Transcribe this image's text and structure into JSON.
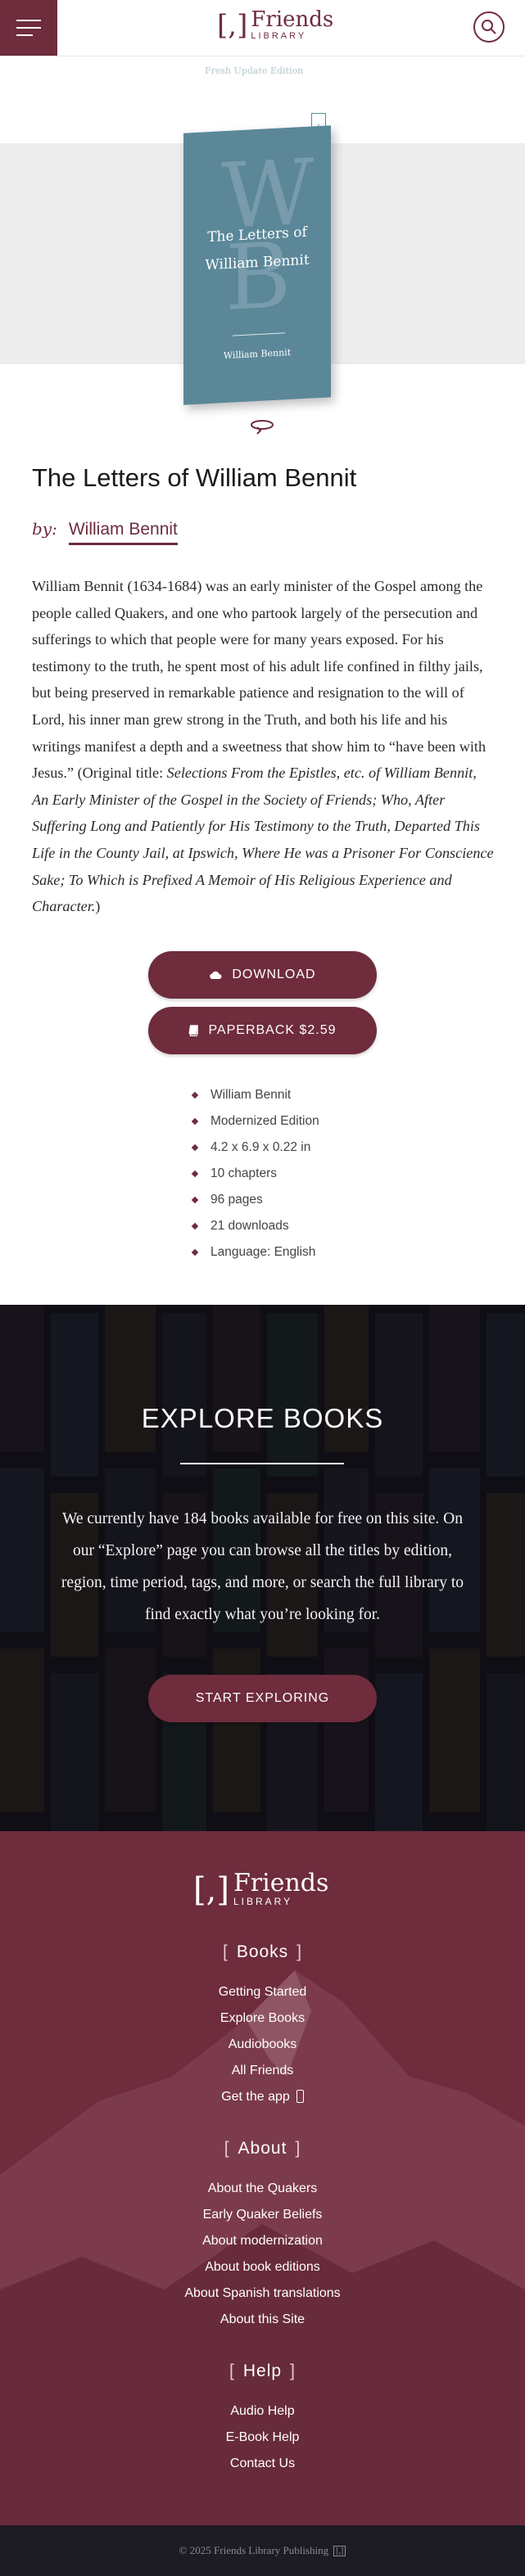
{
  "header": {
    "logo_bracket": "[,]",
    "logo_word": "Friends",
    "logo_sub": "LIBRARY",
    "menu_icon": "hamburger-icon",
    "search_icon": "search-icon"
  },
  "book_cover": {
    "edition_tag": "Fresh Update Edition",
    "title_line1": "The Letters of",
    "title_line2": "William Bennit",
    "big_letters": "WB",
    "author": "William Bennit",
    "color": "#5b8799"
  },
  "book": {
    "title": "The Letters of William Bennit",
    "by_label": "by:",
    "author": "William Bennit",
    "description_plain": "William Bennit (1634-1684) was an early minister of the Gospel among the people called Quakers, and one who partook largely of the persecution and sufferings to which that people were for many years exposed. For his testimony to the truth, he spent most of his adult life confined in filthy jails, but being preserved in remarkable patience and resignation to the will of Lord, his inner man grew strong in the Truth, and both his life and his writings manifest a depth and a sweetness that show him to “have been with Jesus.” (Original title: ",
    "description_italic": "Selections From the Epistles, etc. of William Bennit, An Early Minister of the Gospel in the Society of Friends; Who, After Suffering Long and Patiently for His Testimony to the Truth, Departed This Life in the County Jail, at Ipswich, Where He was a Prisoner For Conscience Sake; To Which is Prefixed A Memoir of His Religious Experience and Character.",
    "description_end": ")"
  },
  "actions": {
    "download_label": "DOWNLOAD",
    "paperback_label": "PAPERBACK $2.59"
  },
  "meta": [
    "William Bennit",
    "Modernized Edition",
    "4.2 x 6.9 x 0.22 in",
    "10 chapters",
    "96 pages",
    "21 downloads",
    "Language: English"
  ],
  "explore": {
    "title": "EXPLORE BOOKS",
    "text": "We currently have 184 books available for free on this site. On our “Explore” page you can browse all the titles by edition, region, time period, tags, and more, or search the full library to find exactly what you’re looking for.",
    "button_label": "START EXPLORING"
  },
  "footer": {
    "logo_bracket": "[,]",
    "logo_word": "Friends",
    "logo_sub": "LIBRARY",
    "sections": [
      {
        "heading": "Books",
        "links": [
          "Getting Started",
          "Explore Books",
          "Audiobooks",
          "All Friends",
          "Get the app"
        ]
      },
      {
        "heading": "About",
        "links": [
          "About the Quakers",
          "Early Quaker Beliefs",
          "About modernization",
          "About book editions",
          "About Spanish translations",
          "About this Site"
        ]
      },
      {
        "heading": "Help",
        "links": [
          "Audio Help",
          "E-Book Help",
          "Contact Us"
        ]
      }
    ],
    "copyright": "© 2025 Friends Library Publishing",
    "copyright_mark": "[,]"
  },
  "colors": {
    "brand": "#6e2c3d",
    "footer_bottom": "#1d1b24"
  }
}
